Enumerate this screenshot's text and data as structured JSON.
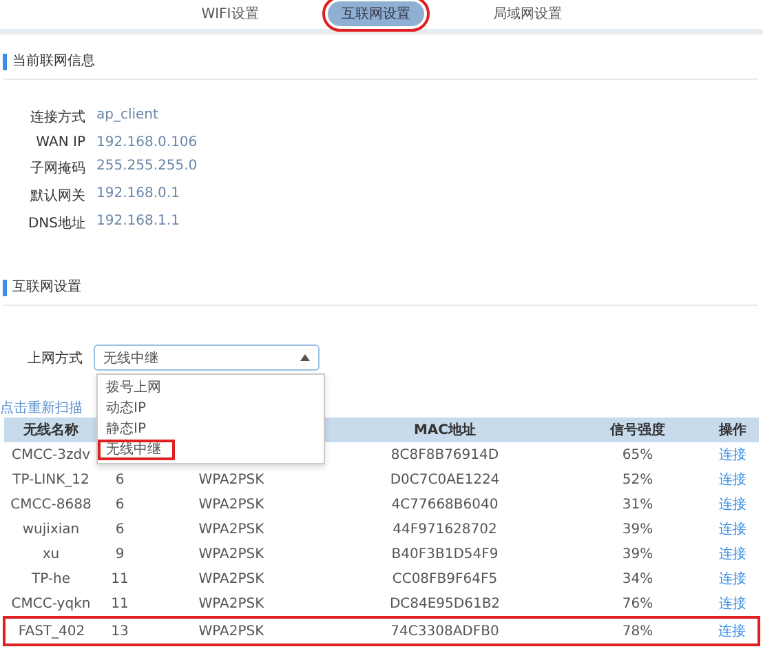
{
  "tabs": [
    {
      "label": "WIFI设置",
      "selected": false,
      "highlighted": false
    },
    {
      "label": "互联网设置",
      "selected": true,
      "highlighted": true
    },
    {
      "label": "局域网设置",
      "selected": false,
      "highlighted": false
    }
  ],
  "current_info": {
    "title": "当前联网信息",
    "rows": [
      {
        "label": "连接方式",
        "value": "ap_client"
      },
      {
        "label": "WAN IP",
        "value": "192.168.0.106"
      },
      {
        "label": "子网掩码",
        "value": "255.255.255.0"
      },
      {
        "label": "默认网关",
        "value": "192.168.0.1"
      },
      {
        "label": "DNS地址",
        "value": "192.168.1.1"
      }
    ]
  },
  "internet_settings": {
    "title": "互联网设置",
    "mode_label": "上网方式",
    "mode_value": "无线中继",
    "dropdown_open": true,
    "options": [
      {
        "label": "拨号上网",
        "highlighted": false
      },
      {
        "label": "动态IP",
        "highlighted": false
      },
      {
        "label": "静态IP",
        "highlighted": false
      },
      {
        "label": "无线中继",
        "highlighted": true
      }
    ],
    "rescan_link": "点击重新扫描"
  },
  "table": {
    "columns": [
      "无线名称",
      "MAC地址",
      "信号强度",
      "操作"
    ],
    "rows": [
      {
        "name": "CMCC-3zdv",
        "mac": "8C8F8B76914D",
        "signal": "65%",
        "action": "连接",
        "highlighted": false
      },
      {
        "name": "TP-LINK_12",
        "channel": "6",
        "security": "WPA2PSK",
        "mac": "D0C7C0AE1224",
        "signal": "52%",
        "action": "连接",
        "highlighted": false
      },
      {
        "name": "CMCC-8688",
        "channel": "6",
        "security": "WPA2PSK",
        "mac": "4C77668B6040",
        "signal": "31%",
        "action": "连接",
        "highlighted": false
      },
      {
        "name": "wujixian",
        "channel": "6",
        "security": "WPA2PSK",
        "mac": "44F971628702",
        "signal": "39%",
        "action": "连接",
        "highlighted": false
      },
      {
        "name": "xu",
        "channel": "9",
        "security": "WPA2PSK",
        "mac": "B40F3B1D54F9",
        "signal": "39%",
        "action": "连接",
        "highlighted": false
      },
      {
        "name": "TP-he",
        "channel": "11",
        "security": "WPA2PSK",
        "mac": "CC08FB9F64F5",
        "signal": "34%",
        "action": "连接",
        "highlighted": false
      },
      {
        "name": "CMCC-yqkn",
        "channel": "11",
        "security": "WPA2PSK",
        "mac": "DC84E95D61B2",
        "signal": "76%",
        "action": "连接",
        "highlighted": false
      },
      {
        "name": "FAST_402",
        "channel": "13",
        "security": "WPA2PSK",
        "mac": "74C3308ADFB0",
        "signal": "78%",
        "action": "连接",
        "highlighted": true
      }
    ]
  }
}
